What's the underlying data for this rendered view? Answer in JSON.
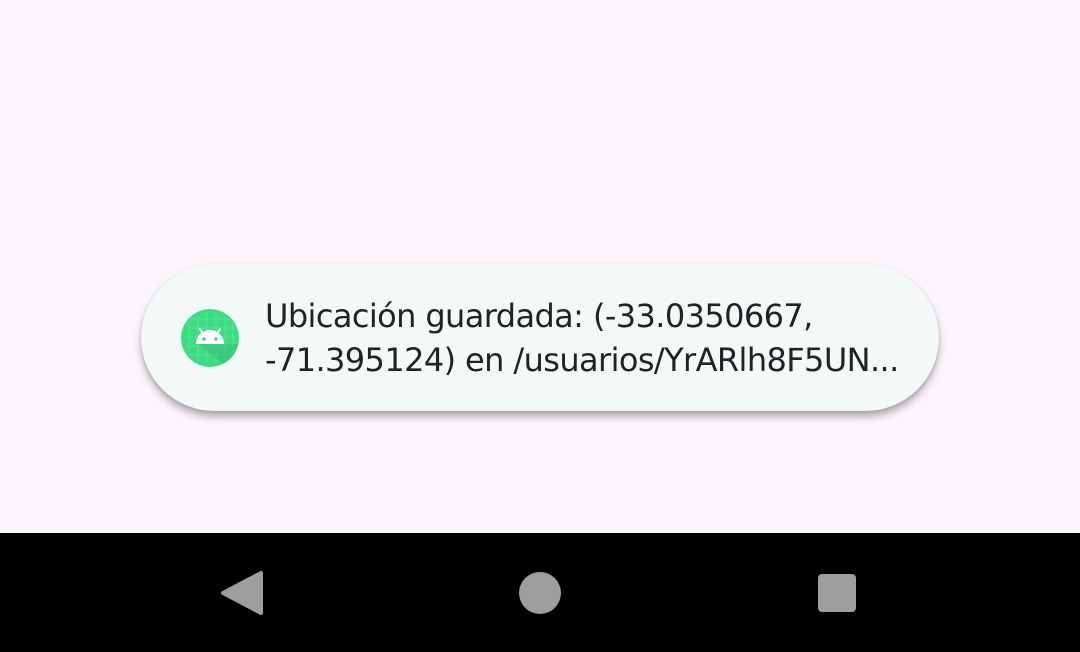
{
  "toast": {
    "line1": "Ubicación guardada: (-33.0350667,",
    "line2": "-71.395124) en /usuarios/YrARlh8F5UN...",
    "icon": "android-app-icon"
  },
  "navbar": {
    "back_icon": "back-triangle-icon",
    "home_icon": "home-circle-icon",
    "recents_icon": "recents-square-icon"
  },
  "colors": {
    "screen_background": "#fcf5fc",
    "toast_background": "#f3f9f7",
    "text": "#1f2328",
    "icon_green": "#3ddc84",
    "navbar_background": "#000000",
    "nav_icon": "#9e9e9e"
  }
}
